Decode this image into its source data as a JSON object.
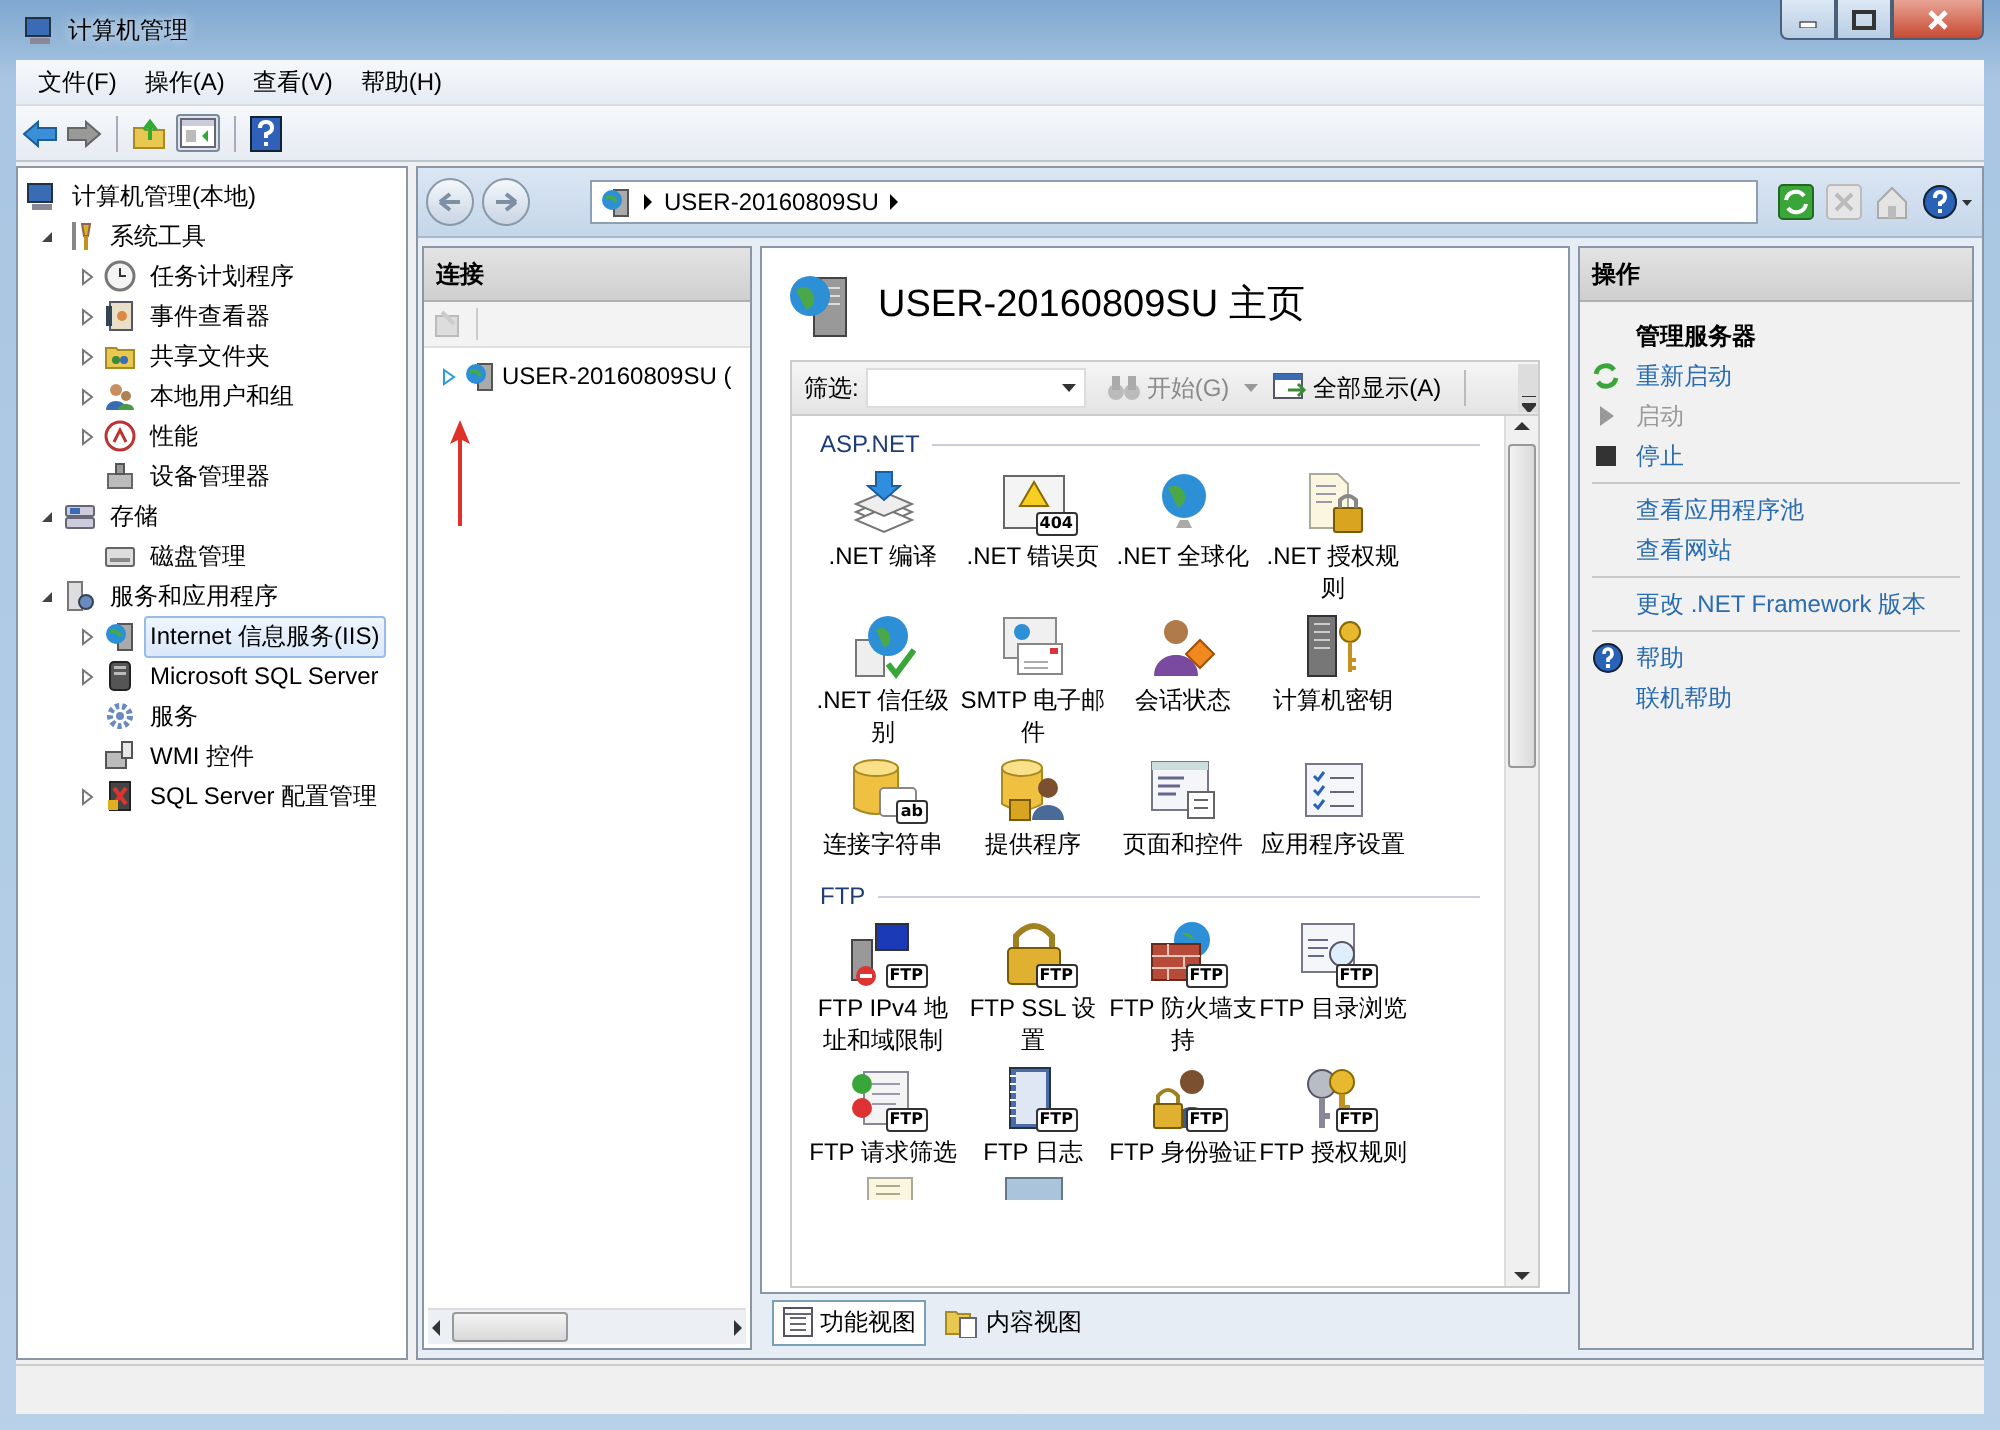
{
  "window": {
    "title": "计算机管理"
  },
  "menu": [
    "文件(F)",
    "操作(A)",
    "查看(V)",
    "帮助(H)"
  ],
  "tree": {
    "label": "计算机管理(本地)",
    "selected": false,
    "children": [
      {
        "label": "系统工具",
        "expanded": true,
        "selected": false,
        "children": [
          {
            "label": "任务计划程序",
            "expanded": false,
            "selected": false
          },
          {
            "label": "事件查看器",
            "expanded": false,
            "selected": false
          },
          {
            "label": "共享文件夹",
            "expanded": false,
            "selected": false
          },
          {
            "label": "本地用户和组",
            "expanded": false,
            "selected": false
          },
          {
            "label": "性能",
            "expanded": false,
            "selected": false
          },
          {
            "label": "设备管理器",
            "selected": false
          }
        ]
      },
      {
        "label": "存储",
        "expanded": true,
        "selected": false,
        "children": [
          {
            "label": "磁盘管理",
            "selected": false
          }
        ]
      },
      {
        "label": "服务和应用程序",
        "expanded": true,
        "selected": false,
        "children": [
          {
            "label": "Internet 信息服务(IIS)",
            "expanded": false,
            "selected": true
          },
          {
            "label": "Microsoft SQL Server",
            "expanded": false,
            "selected": false
          },
          {
            "label": "服务",
            "selected": false
          },
          {
            "label": "WMI 控件",
            "selected": false
          },
          {
            "label": "SQL Server 配置管理",
            "expanded": false,
            "selected": false
          }
        ]
      }
    ]
  },
  "address": {
    "crumbs": [
      "USER-20160809SU"
    ]
  },
  "connections": {
    "title": "连接",
    "items": [
      {
        "label": "USER-20160809SU (",
        "expanded": false,
        "selected": false
      }
    ]
  },
  "home": {
    "title": "USER-20160809SU 主页",
    "filter_label": "筛选:",
    "start_button": "开始(G)",
    "show_all_button": "全部显示(A)",
    "groups": [
      {
        "title": "ASP.NET",
        "features": [
          {
            "label": ".NET 编译"
          },
          {
            "label": ".NET 错误页",
            "icon_text": "404"
          },
          {
            "label": ".NET 全球化"
          },
          {
            "label": ".NET 授权规则"
          },
          {
            "label": ".NET 信任级别"
          },
          {
            "label": "SMTP 电子邮件"
          },
          {
            "label": "会话状态"
          },
          {
            "label": "计算机密钥"
          },
          {
            "label": "连接字符串",
            "icon_text": "ab"
          },
          {
            "label": "提供程序"
          },
          {
            "label": "页面和控件"
          },
          {
            "label": "应用程序设置"
          }
        ]
      },
      {
        "title": "FTP",
        "features": [
          {
            "label": "FTP IPv4 地址和域限制",
            "icon_text": "FTP"
          },
          {
            "label": "FTP SSL 设置",
            "icon_text": "FTP"
          },
          {
            "label": "FTP 防火墙支持",
            "icon_text": "FTP"
          },
          {
            "label": "FTP 目录浏览",
            "icon_text": "FTP"
          },
          {
            "label": "FTP 请求筛选",
            "icon_text": "FTP"
          },
          {
            "label": "FTP 日志",
            "icon_text": "FTP"
          },
          {
            "label": "FTP 身份验证",
            "icon_text": "FTP"
          },
          {
            "label": "FTP 授权规则",
            "icon_text": "FTP"
          }
        ]
      }
    ]
  },
  "views": [
    {
      "label": "功能视图",
      "selected": true
    },
    {
      "label": "内容视图",
      "selected": false
    }
  ],
  "actions": {
    "title": "操作",
    "groups": [
      {
        "heading": "管理服务器",
        "items": [
          {
            "label": "重新启动",
            "disabled": false
          },
          {
            "label": "启动",
            "disabled": true
          },
          {
            "label": "停止",
            "disabled": false
          }
        ]
      },
      {
        "items": [
          {
            "label": "查看应用程序池",
            "disabled": false
          },
          {
            "label": "查看网站",
            "disabled": false
          }
        ]
      },
      {
        "items": [
          {
            "label": "更改 .NET Framework 版本",
            "disabled": false
          }
        ]
      },
      {
        "items": [
          {
            "label": "帮助",
            "disabled": false
          },
          {
            "label": "联机帮助",
            "disabled": false
          }
        ]
      }
    ]
  }
}
